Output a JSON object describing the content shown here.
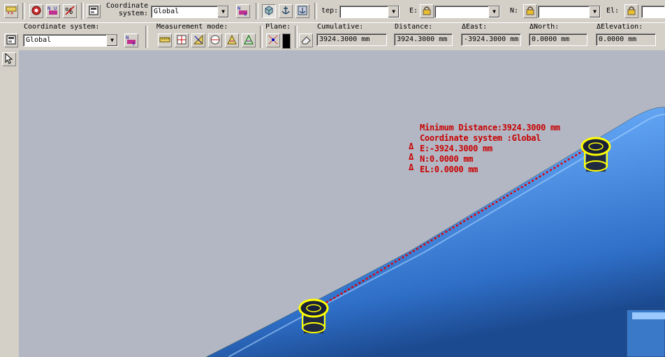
{
  "toolbar1": {
    "coord_label_line1": "Coordinate",
    "coord_label_line2": "system:",
    "coord_value": "Global",
    "step_label": "tep:",
    "e_label": "E:",
    "n_label": "N:",
    "el_label": "El:",
    "step_value": "",
    "e_value": "",
    "n_value": "",
    "el_value": ""
  },
  "toolbar2": {
    "coord_label": "Coordinate system:",
    "coord_value": "Global",
    "mode_label": "Measurement mode:",
    "plane_label": "Plane:",
    "cumulative_label": "Cumulative:",
    "cumulative_value": "3924.3000 mm",
    "distance_label": "Distance:",
    "distance_value": "3924.3000 mm",
    "deast_label": "ΔEast:",
    "deast_value": "-3924.3000 mm",
    "dnorth_label": "ΔNorth:",
    "dnorth_value": "0.0000 mm",
    "delev_label": "ΔElevation:",
    "delev_value": "0.0000 mm"
  },
  "measurement": {
    "line1": "Minimum Distance:3924.3000 mm",
    "line2": "Coordinate system :Global",
    "delta_symbol": "Δ",
    "line3": "E:-3924.3000 mm",
    "line4": "N:0.0000 mm",
    "line5": "EL:0.0000 mm"
  },
  "colors": {
    "viewport_bg": "#b3b7c3",
    "pipe": "#5ea0f0",
    "measure_text": "#c80000",
    "highlight": "#ffff00"
  }
}
